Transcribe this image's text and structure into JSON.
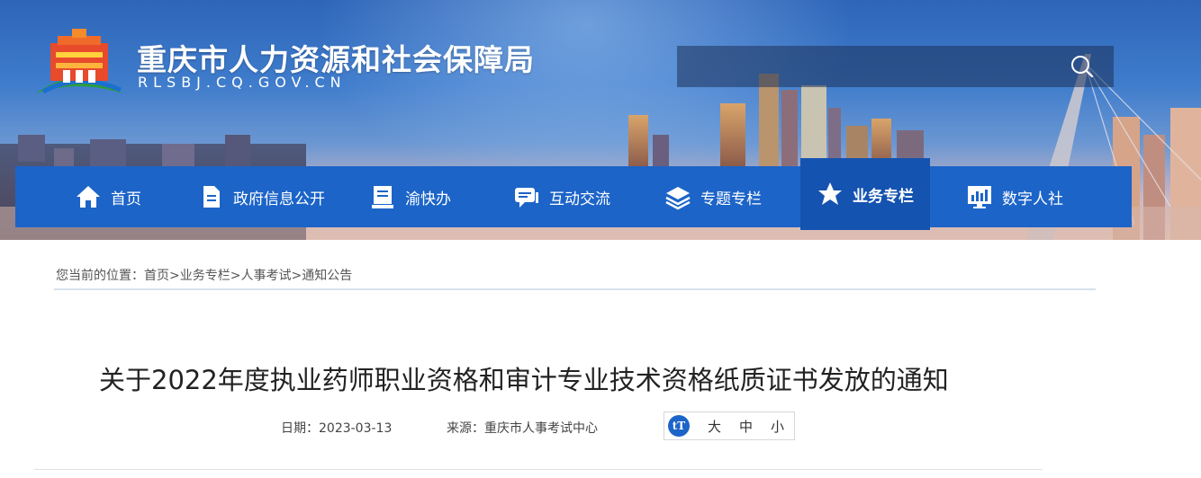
{
  "header": {
    "site_title": "重庆市人力资源和社会保障局",
    "site_domain": "RLSBJ.CQ.GOV.CN",
    "search": {
      "placeholder": "",
      "value": ""
    }
  },
  "nav": {
    "items": [
      {
        "label": "首页",
        "icon": "home-icon"
      },
      {
        "label": "政府信息公开",
        "icon": "document-icon"
      },
      {
        "label": "渝快办",
        "icon": "form-icon"
      },
      {
        "label": "互动交流",
        "icon": "chat-icon"
      },
      {
        "label": "专题专栏",
        "icon": "layers-icon"
      },
      {
        "label": "业务专栏",
        "icon": "star-icon",
        "active": true
      },
      {
        "label": "数字人社",
        "icon": "chart-icon"
      }
    ]
  },
  "breadcrumb": {
    "prefix": "您当前的位置：",
    "items": [
      "首页",
      "业务专栏",
      "人事考试",
      "通知公告"
    ],
    "separator": ">"
  },
  "article": {
    "title": "关于2022年度执业药师职业资格和审计专业技术资格纸质证书发放的通知",
    "date": "日期：2023-03-13",
    "source": "来源：重庆市人事考试中心",
    "font_size": {
      "icon_label": "tT",
      "options": [
        "大",
        "中",
        "小"
      ]
    }
  },
  "colors": {
    "nav_bg": "#1c64c8",
    "nav_active_bg": "#1553b0",
    "title_text": "#222222"
  }
}
